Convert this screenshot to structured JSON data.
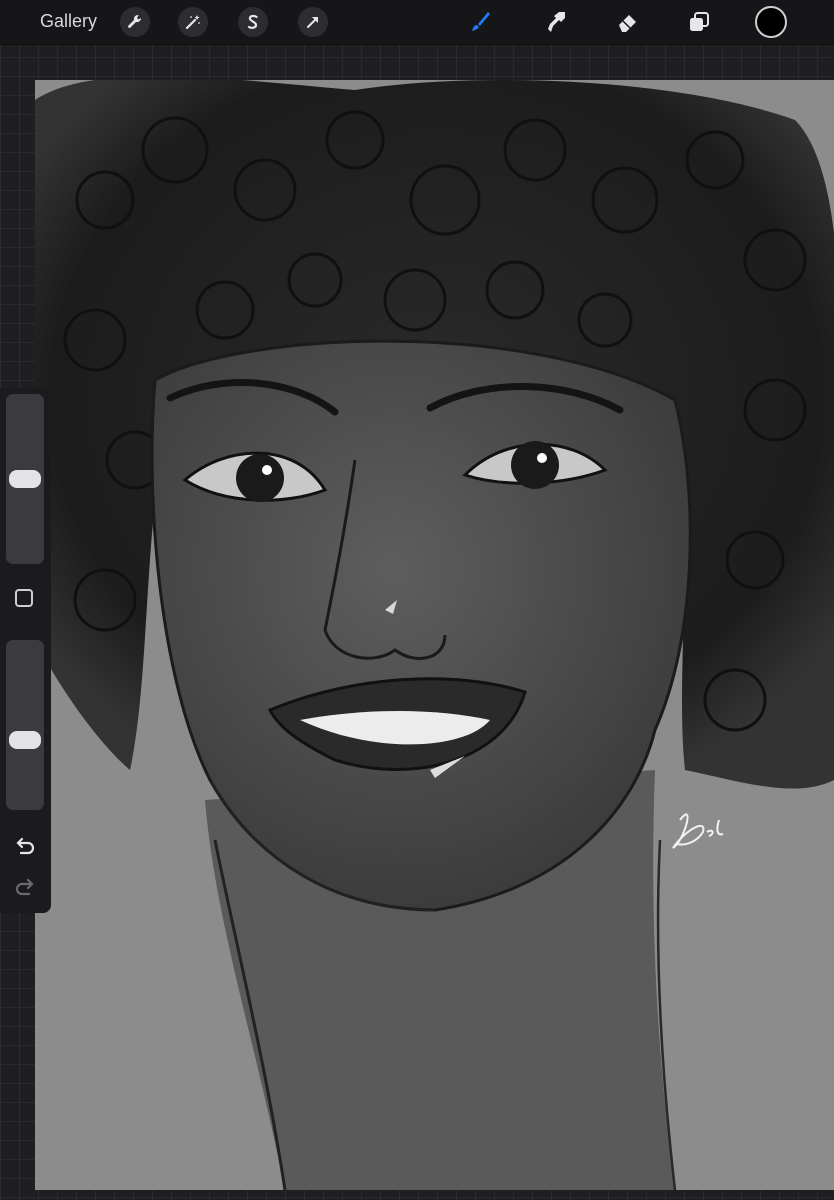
{
  "toolbar": {
    "gallery_label": "Gallery",
    "left_tools": [
      "wrench-icon",
      "magic-wand-icon",
      "selection-icon",
      "move-arrow-icon"
    ],
    "right_tools": [
      "brush-icon",
      "smudge-icon",
      "eraser-icon",
      "layers-icon"
    ],
    "active_tool": "brush",
    "accent_color": "#1e7bf6",
    "current_color": "#000000"
  },
  "sidebar": {
    "brush_size_level": 0.5,
    "opacity_level": 0.4,
    "buttons": [
      "modify-square-icon",
      "undo-icon",
      "redo-icon"
    ]
  },
  "canvas": {
    "signature": "Bel 26"
  }
}
